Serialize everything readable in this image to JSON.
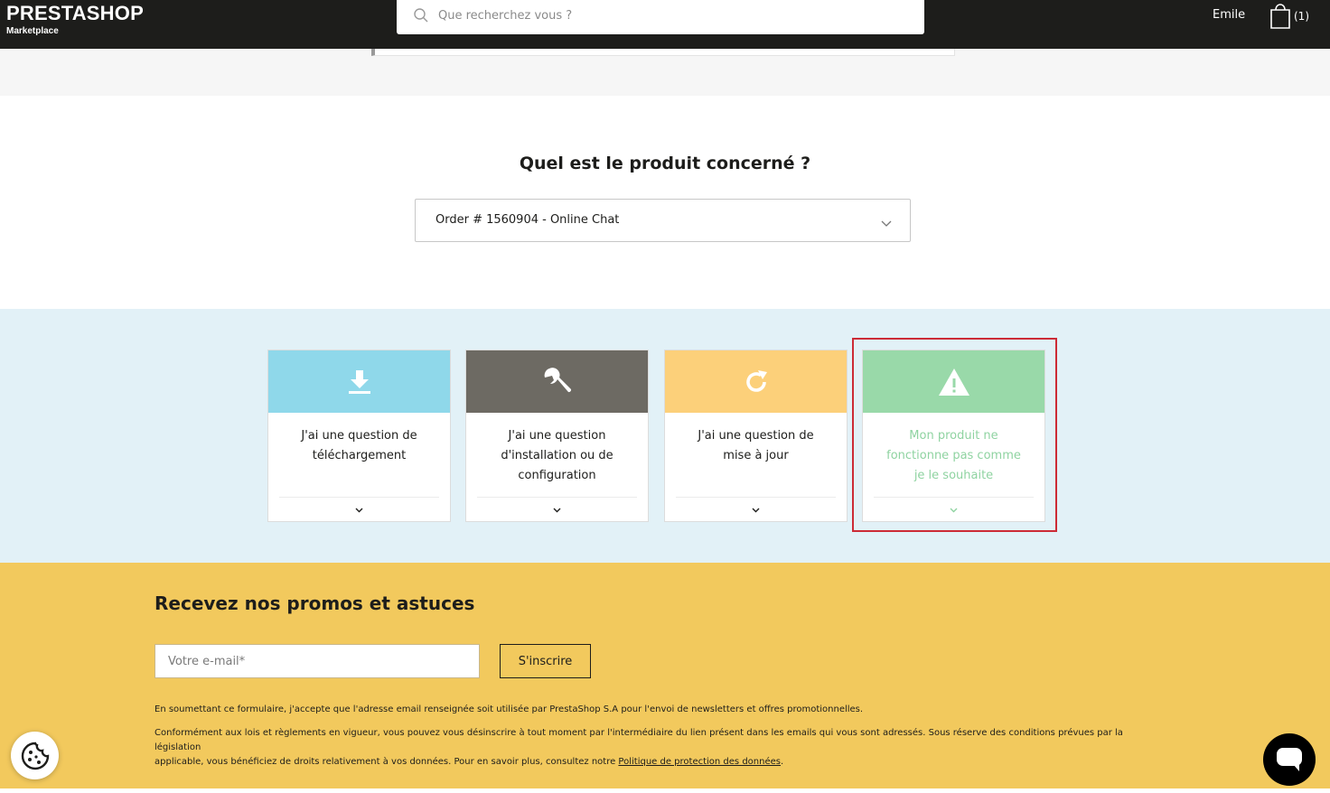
{
  "header": {
    "logo_name": "PRESTASHOP",
    "logo_sub": "Marketplace",
    "search_placeholder": "Que recherchez vous ?",
    "user_name": "Emile",
    "cart_count": "(1)"
  },
  "product": {
    "title": "Quel est le produit concerné ?",
    "selected": "Order # 1560904 - Online Chat"
  },
  "cards": [
    {
      "label_lines": [
        "J'ai une question de",
        "téléchargement"
      ],
      "icon": "download-icon",
      "color": "#8fd8ea"
    },
    {
      "label_lines": [
        "J'ai une question",
        "d'installation ou de",
        "configuration"
      ],
      "icon": "wrench-icon",
      "color": "#6d6a63"
    },
    {
      "label_lines": [
        "J'ai une question de",
        "mise à jour"
      ],
      "icon": "refresh-icon",
      "color": "#fcd07a"
    },
    {
      "label_lines": [
        "Mon produit ne",
        "fonctionne pas comme",
        "je le souhaite"
      ],
      "icon": "warning-icon",
      "color": "#99d9a9",
      "selected": true
    }
  ],
  "newsletter": {
    "title": "Recevez nos promos et astuces",
    "email_placeholder": "Votre e-mail*",
    "subscribe_label": "S'inscrire",
    "legal_1": "En soumettant ce formulaire, j'accepte que l'adresse email renseignée soit utilisée par PrestaShop S.A pour l'envoi de newsletters et offres promotionnelles.",
    "legal_2_line1": "Conformément aux lois et règlements en vigueur, vous pouvez vous désinscrire à tout moment par l'intermédiaire du lien présent dans les emails qui vous sont adressés. Sous réserve des conditions prévues par la législation",
    "legal_2_line2": "applicable, vous bénéficiez de droits relativement à vos données. Pour en savoir plus, consultez notre",
    "legal_link": "Politique de protection des données",
    "legal_end": "."
  },
  "colors": {
    "header_bg": "#1d1d1b",
    "cards_band": "#e2f1f7",
    "newsletter_bg": "#f2c95d",
    "selection": "#cc2b36"
  }
}
